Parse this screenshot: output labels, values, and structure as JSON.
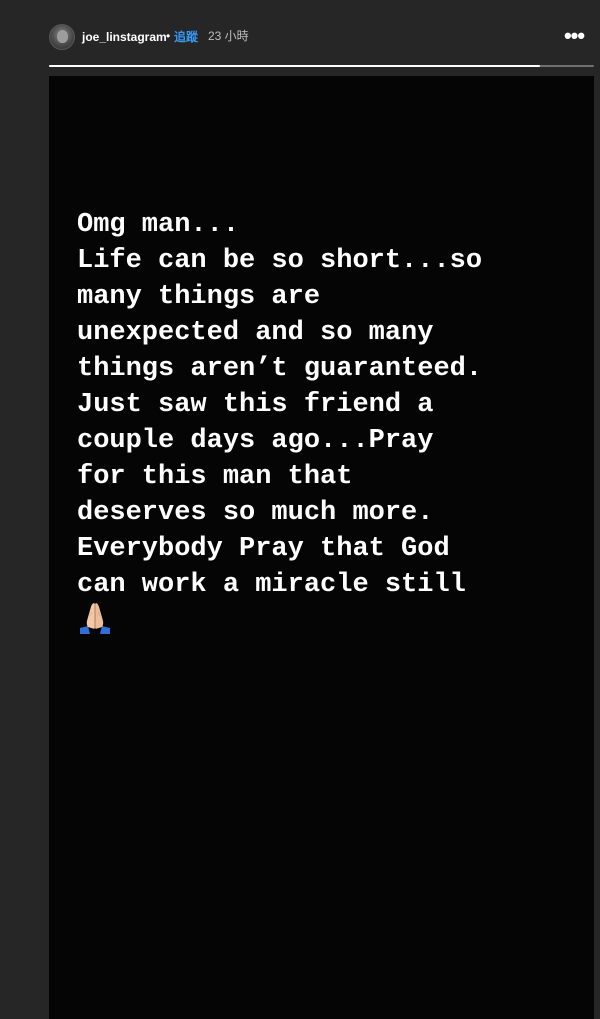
{
  "header": {
    "username": "joe_linstagram",
    "separator": "•",
    "follow_label": "追蹤",
    "time_ago": "23 小時",
    "more_label": "•••"
  },
  "progress": {
    "fraction": 0.9
  },
  "story": {
    "text_lines": [
      "Omg man...",
      "Life can be so short...so",
      "many things are",
      "unexpected and so many",
      "things aren’t guaranteed.",
      "Just saw this friend a",
      "couple days ago...Pray",
      "for this man that",
      "deserves so much more.",
      "Everybody Pray that God",
      "can work a miracle still"
    ],
    "emoji_icon": "folded-hands-icon"
  },
  "colors": {
    "background": "#262626",
    "story_background": "#050505",
    "follow": "#3897f0"
  }
}
